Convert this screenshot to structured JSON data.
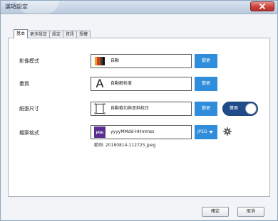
{
  "window": {
    "title": "選項設定",
    "close_label": "×"
  },
  "tabs": [
    {
      "label": "基本",
      "active": true
    },
    {
      "label": "更多設定",
      "active": false
    },
    {
      "label": "設定",
      "active": false
    },
    {
      "label": "資訊",
      "active": false
    },
    {
      "label": "授權",
      "active": false
    }
  ],
  "rows": {
    "image_mode": {
      "label": "影像模式",
      "value": "自動",
      "icon": "color-mode-icon",
      "button": "變更"
    },
    "quality": {
      "label": "畫質",
      "value": "自動解析度",
      "icon": "letter-a-icon",
      "button": "變更"
    },
    "paper_size": {
      "label": "紙張尺寸",
      "value": "自動裁切與歪斜校正",
      "icon": "page-crop-icon",
      "button": "變更",
      "toggle_label": "雙面",
      "toggle_on": true
    },
    "file_format": {
      "label": "檔案格式",
      "badge": "JPEG",
      "value": "yyyyMMdd-HHmmss",
      "select_value": "JPEG",
      "icon": "jpeg-badge-icon",
      "settings_icon": "gear-icon",
      "example": "範例: 20180814-112725.jpeg"
    }
  },
  "footer": {
    "ok_label": "確定",
    "cancel_label": "取消"
  },
  "colors": {
    "accent": "#2f8ddb",
    "toggle_bg": "#1f4b8a",
    "close_red": "#c9413a"
  }
}
